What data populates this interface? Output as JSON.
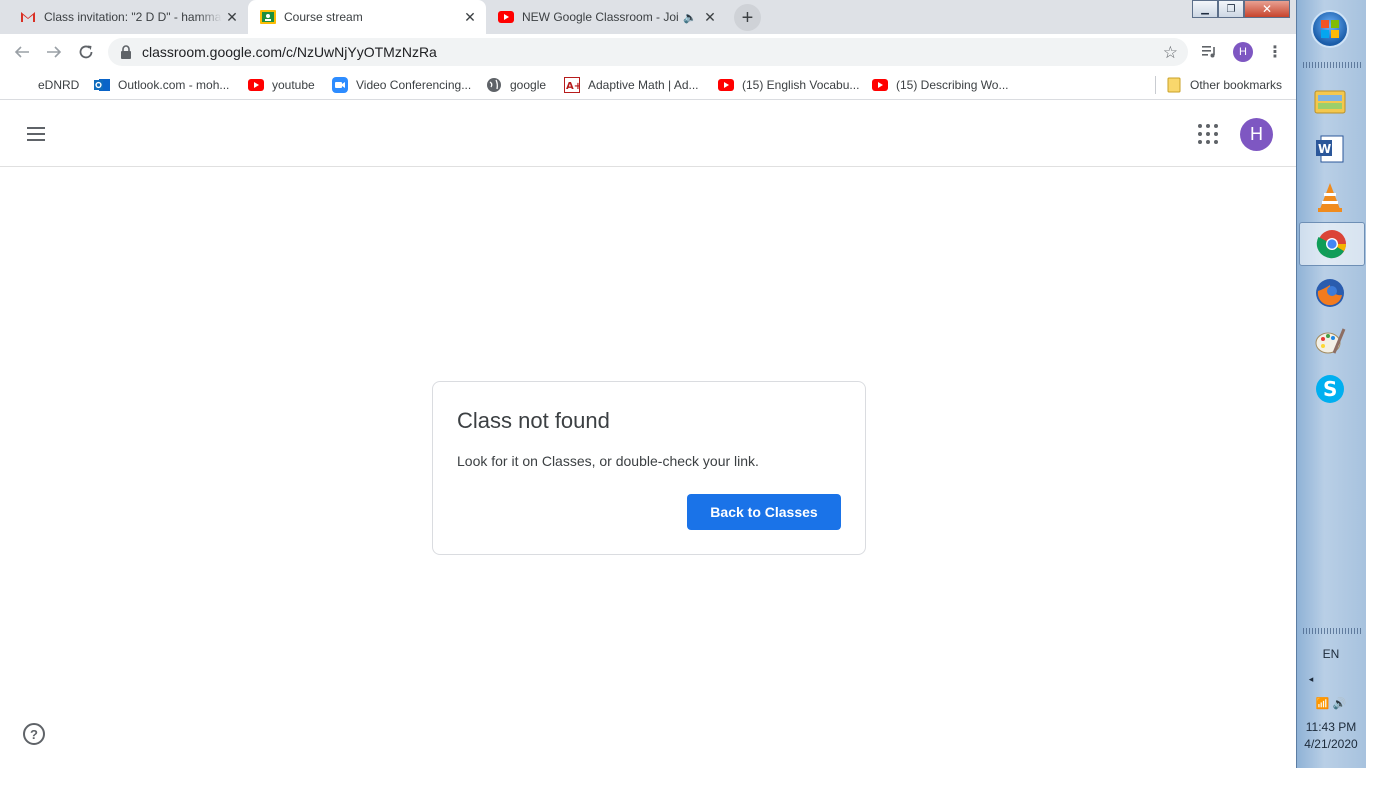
{
  "tabs": [
    {
      "title": "Class invitation: \"2 D D\" - hamma",
      "favicon": "gmail-icon",
      "color": "#d93025"
    },
    {
      "title": "Course stream",
      "favicon": "classroom-icon",
      "color": "#1e8e3e"
    },
    {
      "title": "NEW Google Classroom - Joi",
      "favicon": "youtube-icon",
      "color": "#ff0000"
    }
  ],
  "toolbar": {
    "url": "classroom.google.com/c/NzUwNjYyOTMzNzRa",
    "profile_initial": "H"
  },
  "bookmarks": [
    {
      "label": "eDNRD",
      "icon": "none"
    },
    {
      "label": "Outlook.com - moh...",
      "icon": "outlook-icon"
    },
    {
      "label": "youtube",
      "icon": "youtube-icon"
    },
    {
      "label": "Video Conferencing...",
      "icon": "zoom-icon"
    },
    {
      "label": "google",
      "icon": "globe-icon"
    },
    {
      "label": "Adaptive Math | Ad...",
      "icon": "aplus-icon"
    },
    {
      "label": "(15) English Vocabu...",
      "icon": "youtube-icon"
    },
    {
      "label": "(15) Describing Wo...",
      "icon": "youtube-icon"
    },
    {
      "label": "Other bookmarks",
      "icon": "folder-icon"
    }
  ],
  "page": {
    "avatar_initial": "H",
    "card": {
      "title": "Class not found",
      "message": "Look for it on Classes, or double-check your link.",
      "button_label": "Back to Classes"
    }
  },
  "taskbar": {
    "language": "EN",
    "time": "11:43 PM",
    "date": "4/21/2020",
    "apps": [
      "explorer-icon",
      "word-icon",
      "vlc-icon",
      "chrome-icon",
      "firefox-icon",
      "paint-icon",
      "skype-icon"
    ]
  },
  "colors": {
    "accent": "#1a73e8",
    "avatar": "#7e57c2"
  }
}
